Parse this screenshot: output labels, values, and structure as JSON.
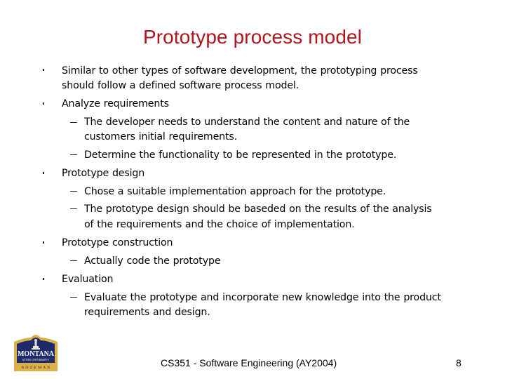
{
  "slide": {
    "title": "Prototype process model",
    "bullets": [
      {
        "lines": [
          "Similar to other types of software development, the prototyping process",
          "should follow a defined software process model."
        ],
        "subitems": []
      },
      {
        "lines": [
          "Analyze requirements"
        ],
        "subitems": [
          {
            "lines": [
              "The developer needs to understand the content and nature of the",
              "customers initial requirements."
            ]
          },
          {
            "lines": [
              "Determine the functionality to be represented in the prototype."
            ]
          }
        ]
      },
      {
        "lines": [
          "Prototype design"
        ],
        "subitems": [
          {
            "lines": [
              "Chose a suitable implementation approach for the prototype."
            ]
          },
          {
            "lines": [
              "The prototype design should be baseded on the results of the analysis",
              "of the requirements and the choice of implementation."
            ]
          }
        ]
      },
      {
        "lines": [
          "Prototype construction"
        ],
        "subitems": [
          {
            "lines": [
              "Actually code the prototype"
            ]
          }
        ]
      },
      {
        "lines": [
          "Evaluation"
        ],
        "subitems": [
          {
            "lines": [
              "Evaluate the prototype and incorporate new knowledge into the product",
              "requirements and design."
            ]
          }
        ]
      }
    ]
  },
  "footer": {
    "course": "CS351 - Software Engineering (AY2004)",
    "page_number": "8",
    "logo": {
      "name": "montana-state-university-logo",
      "line1": "MONTANA",
      "line2": "STATE UNIVERSITY",
      "line3": "B O Z E M A N"
    }
  },
  "colors": {
    "title": "#b0161e",
    "logo_navy": "#1f2a6b",
    "logo_gold": "#d9b04a"
  }
}
